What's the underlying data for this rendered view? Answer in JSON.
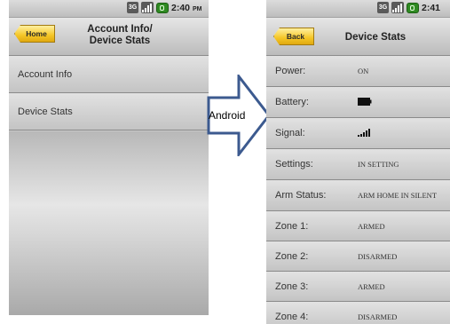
{
  "left_screen": {
    "status": {
      "net": "3G",
      "time": "2:40",
      "ampm": "PM"
    },
    "home_label": "Home",
    "title_line1": "Account Info/",
    "title_line2": "Device Stats",
    "items": [
      {
        "label": "Account Info"
      },
      {
        "label": "Device Stats"
      }
    ]
  },
  "arrow": {
    "label": "Android"
  },
  "right_screen": {
    "status": {
      "net": "3G",
      "time": "2:41"
    },
    "back_label": "Back",
    "title": "Device Stats",
    "rows": [
      {
        "label": "Power:",
        "value": "ON",
        "icon": null
      },
      {
        "label": "Battery:",
        "value": "",
        "icon": "battery-icon"
      },
      {
        "label": "Signal:",
        "value": "",
        "icon": "signal-bars-icon"
      },
      {
        "label": "Settings:",
        "value": "IN SETTING",
        "icon": null
      },
      {
        "label": "Arm Status:",
        "value": "ARM HOME IN SILENT",
        "icon": null
      },
      {
        "label": "Zone 1:",
        "value": "ARMED",
        "icon": null
      },
      {
        "label": "Zone 2:",
        "value": "DISARMED",
        "icon": null
      },
      {
        "label": "Zone 3:",
        "value": "ARMED",
        "icon": null
      },
      {
        "label": "Zone 4:",
        "value": "DISARMED",
        "icon": null
      }
    ]
  },
  "colors": {
    "button_yellow": "#f5c626",
    "arrow_outline": "#3c5a8f",
    "battery_green": "#2f8a22"
  }
}
